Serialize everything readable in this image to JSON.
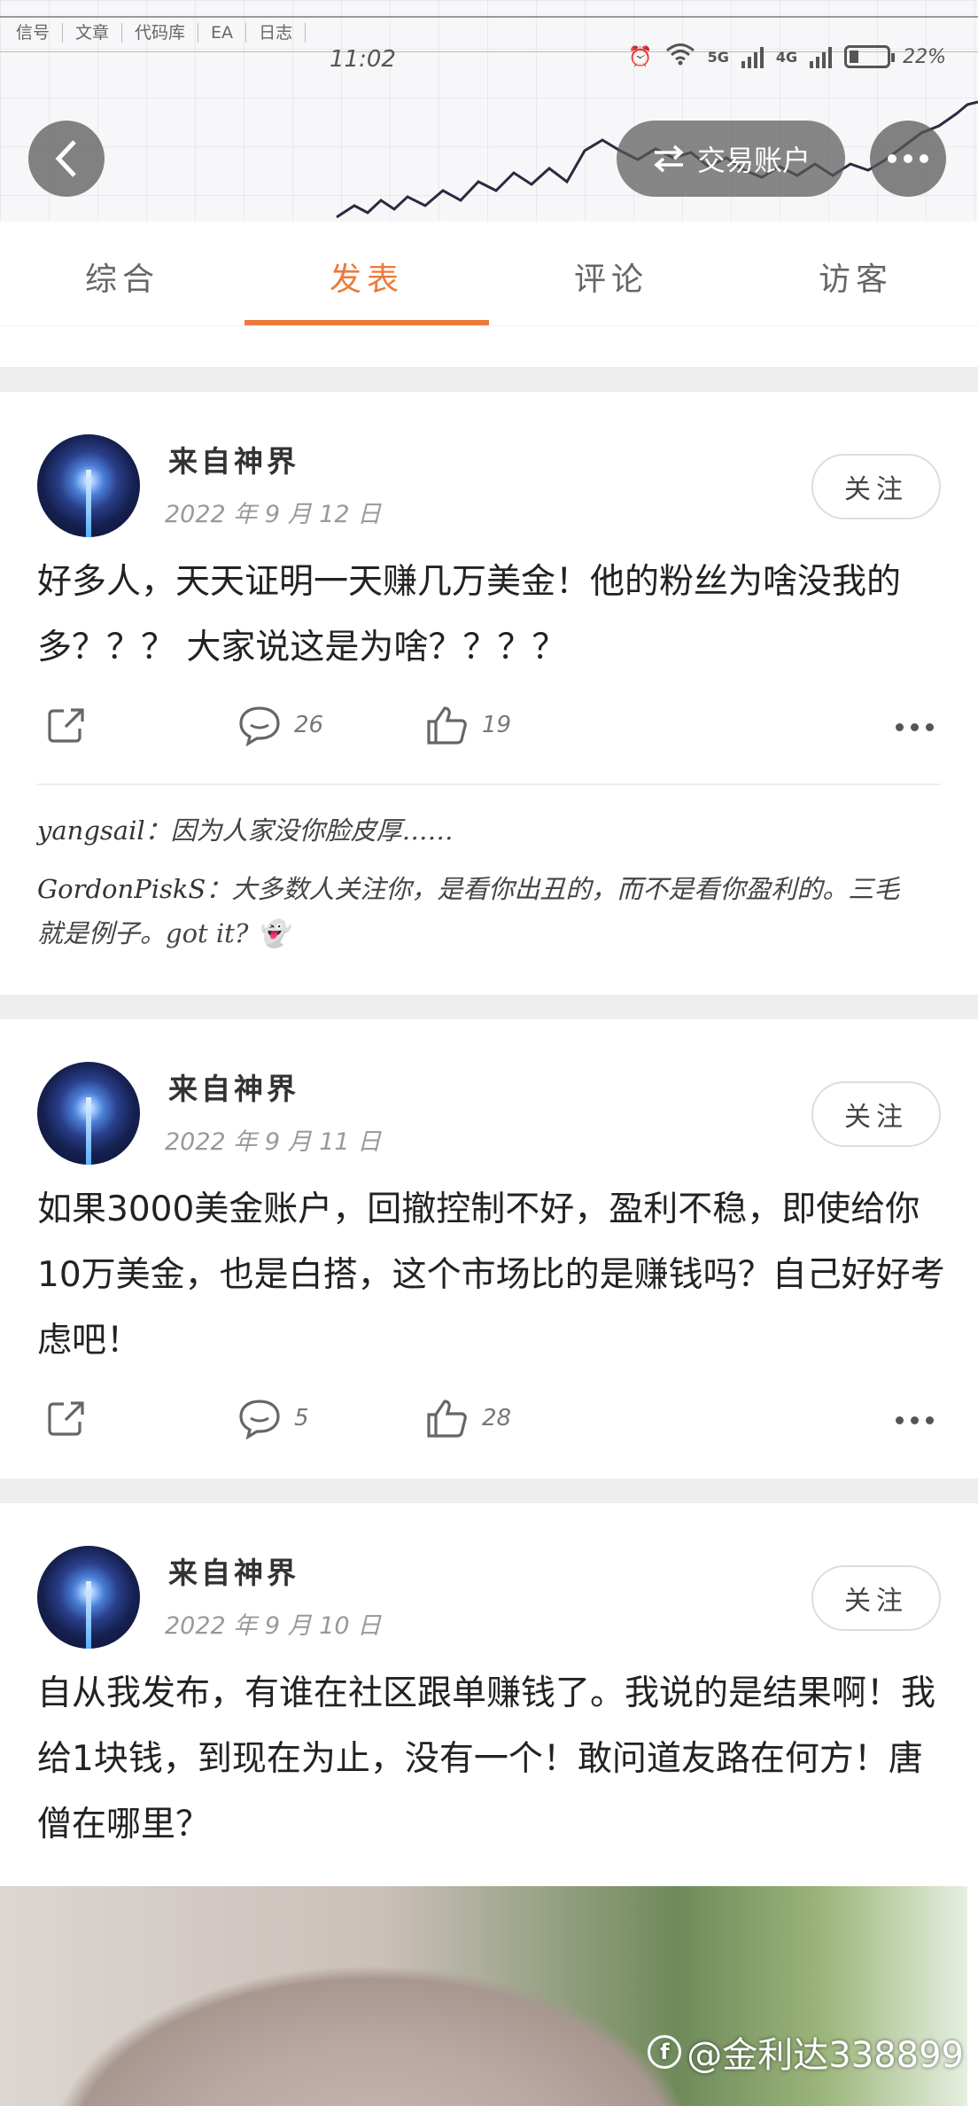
{
  "top_tabs": [
    "信号",
    "文章",
    "代码库",
    "EA",
    "日志"
  ],
  "status": {
    "time": "11:02",
    "net1": "5G",
    "net2": "4G",
    "battery": "22%"
  },
  "header": {
    "account_label": "交易账户"
  },
  "tabs": [
    {
      "label": "综合"
    },
    {
      "label": "发表"
    },
    {
      "label": "评论"
    },
    {
      "label": "访客"
    }
  ],
  "posts": [
    {
      "author": "来自神界",
      "date": "2022 年 9 月 12 日",
      "follow": "关注",
      "text": "好多人，天天证明一天赚几万美金！他的粉丝为啥没我的多？？？ 大家说这是为啥？？？？",
      "comments": "26",
      "likes": "19",
      "replies": [
        {
          "user": "yangsail",
          "text": "：因为人家没你脸皮厚……"
        },
        {
          "user": "GordonPiskS",
          "text": "：大多数人关注你，是看你出丑的，而不是看你盈利的。三毛就是例子。got it? 👻"
        }
      ]
    },
    {
      "author": "来自神界",
      "date": "2022 年 9 月 11 日",
      "follow": "关注",
      "text": "如果3000美金账户，回撤控制不好，盈利不稳，即使给你10万美金，也是白搭，这个市场比的是赚钱吗？自己好好考虑吧！",
      "comments": "5",
      "likes": "28"
    },
    {
      "author": "来自神界",
      "date": "2022 年 9 月 10 日",
      "follow": "关注",
      "text": "自从我发布，有谁在社区跟单赚钱了。我说的是结果啊！我给1块钱，到现在为止，没有一个！敢问道友路在何方！唐僧在哪里？"
    }
  ],
  "watermark": {
    "text": "@金利达338899"
  },
  "colors": {
    "accent": "#ec7a3d",
    "separator": "#eeeeee"
  }
}
